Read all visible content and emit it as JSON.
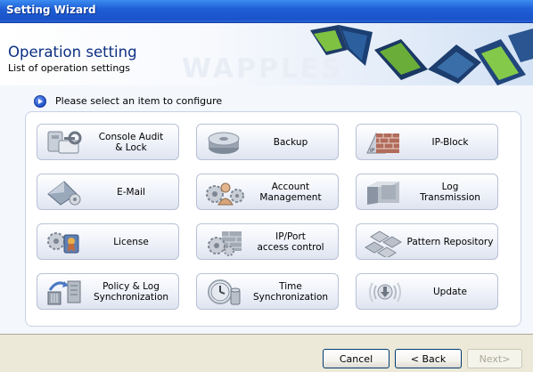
{
  "window": {
    "title": "Setting Wizard"
  },
  "header": {
    "title": "Operation setting",
    "subtitle": "List of operation settings",
    "watermark": "WAPPLES"
  },
  "prompt": {
    "text": "Please select an item to configure"
  },
  "items": [
    {
      "label": "Console Audit\n& Lock",
      "icon": "console-audit-icon"
    },
    {
      "label": "Backup",
      "icon": "backup-disk-icon"
    },
    {
      "label": "IP-Block",
      "icon": "ip-block-wall-icon"
    },
    {
      "label": "E-Mail",
      "icon": "email-icon"
    },
    {
      "label": "Account\nManagement",
      "icon": "account-gears-icon"
    },
    {
      "label": "Log\nTransmission",
      "icon": "log-transmission-icon"
    },
    {
      "label": "License",
      "icon": "license-icon"
    },
    {
      "label": "IP/Port\naccess control",
      "icon": "ip-port-gears-icon"
    },
    {
      "label": "Pattern Repository",
      "icon": "pattern-repository-icon"
    },
    {
      "label": "Policy & Log\nSynchronization",
      "icon": "policy-sync-icon"
    },
    {
      "label": "Time\nSynchronization",
      "icon": "time-sync-icon"
    },
    {
      "label": "Update",
      "icon": "update-icon"
    }
  ],
  "buttons": {
    "cancel": "Cancel",
    "back": "< Back",
    "next": "Next>"
  },
  "colors": {
    "title_bar": "#1f5fd6",
    "heading": "#0c2f83",
    "panel_border": "#c9d3e5"
  }
}
